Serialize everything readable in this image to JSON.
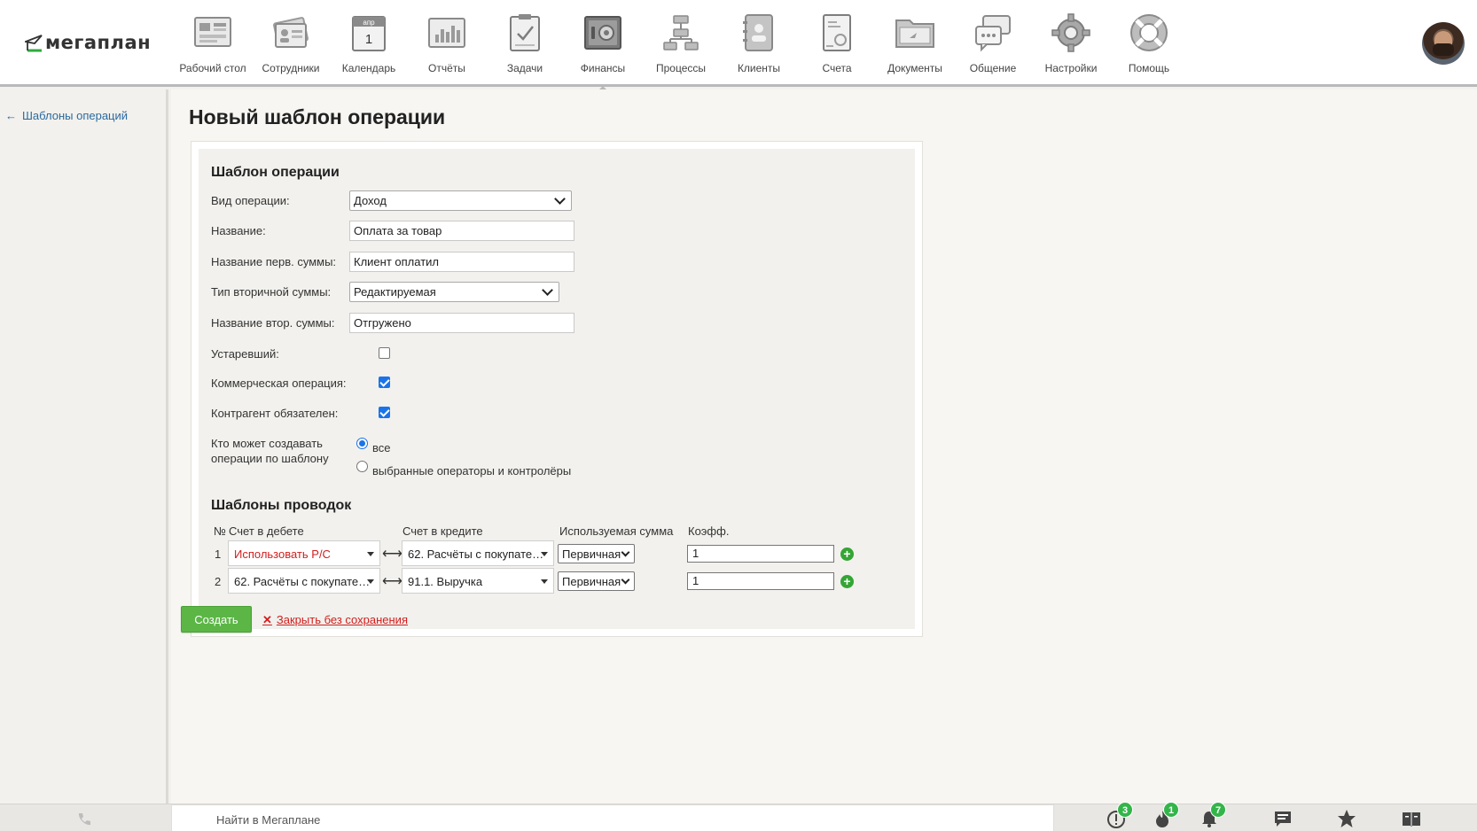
{
  "app": {
    "logo_text": "мегаплан"
  },
  "nav": [
    {
      "label": "Рабочий стол",
      "icon": "desktop-icon"
    },
    {
      "label": "Сотрудники",
      "icon": "employees-icon"
    },
    {
      "label": "Календарь",
      "icon": "calendar-icon",
      "cal_month": "апр",
      "cal_day": "1"
    },
    {
      "label": "Отчёты",
      "icon": "reports-icon"
    },
    {
      "label": "Задачи",
      "icon": "tasks-icon"
    },
    {
      "label": "Финансы",
      "icon": "finance-icon",
      "active": true
    },
    {
      "label": "Процессы",
      "icon": "processes-icon"
    },
    {
      "label": "Клиенты",
      "icon": "clients-icon"
    },
    {
      "label": "Счета",
      "icon": "invoices-icon"
    },
    {
      "label": "Документы",
      "icon": "documents-icon"
    },
    {
      "label": "Общение",
      "icon": "chat-icon"
    },
    {
      "label": "Настройки",
      "icon": "settings-icon"
    },
    {
      "label": "Помощь",
      "icon": "help-icon"
    }
  ],
  "sidebar": {
    "back_arrow": "←",
    "back_label": "Шаблоны операций"
  },
  "page": {
    "title": "Новый шаблон операции"
  },
  "form": {
    "section_title": "Шаблон операции",
    "op_type": {
      "label": "Вид операции:",
      "value": "Доход"
    },
    "name": {
      "label": "Название:",
      "value": "Оплата за товар"
    },
    "first_sum_name": {
      "label": "Название перв. суммы:",
      "value": "Клиент оплатил"
    },
    "second_sum_type": {
      "label": "Тип вторичной суммы:",
      "value": "Редактируемая"
    },
    "second_sum_name": {
      "label": "Название втор. суммы:",
      "value": "Отгружено"
    },
    "obsolete": {
      "label": "Устаревший:",
      "checked": false
    },
    "commercial": {
      "label": "Коммерческая операция:",
      "checked": true
    },
    "counterparty_required": {
      "label": "Контрагент обязателен:",
      "checked": true
    },
    "who_can_create": {
      "label_line1": "Кто может создавать",
      "label_line2": "операции по шаблону",
      "options": [
        "все",
        "выбранные операторы и контролёры"
      ],
      "selected": 0
    }
  },
  "postings": {
    "section_title": "Шаблоны проводок",
    "headers": {
      "num": "№",
      "debit": "Счет в дебете",
      "credit": "Счет в кредите",
      "sum": "Используемая сумма",
      "coef": "Коэфф."
    },
    "arrow": "⟷",
    "rows": [
      {
        "num": "1",
        "debit": "Использовать Р/С",
        "debit_highlight": true,
        "credit": "62. Расчёты с покупате…",
        "sum": "Первичная",
        "coef": "1"
      },
      {
        "num": "2",
        "debit": "62. Расчёты с покупате…",
        "debit_highlight": false,
        "credit": "91.1. Выручка",
        "sum": "Первичная",
        "coef": "1"
      }
    ],
    "add_symbol": "+"
  },
  "actions": {
    "create": "Создать",
    "close_symbol": "✕",
    "close": "Закрыть без сохранения"
  },
  "footer": {
    "search_placeholder": "Найти в Мегаплане",
    "badges": {
      "alerts": "3",
      "hot": "1",
      "notifications": "7"
    }
  },
  "colors": {
    "accent_green": "#5bb646",
    "link_blue": "#2b6a9f",
    "danger_red": "#d21e1e",
    "badge_green": "#33b54a"
  }
}
